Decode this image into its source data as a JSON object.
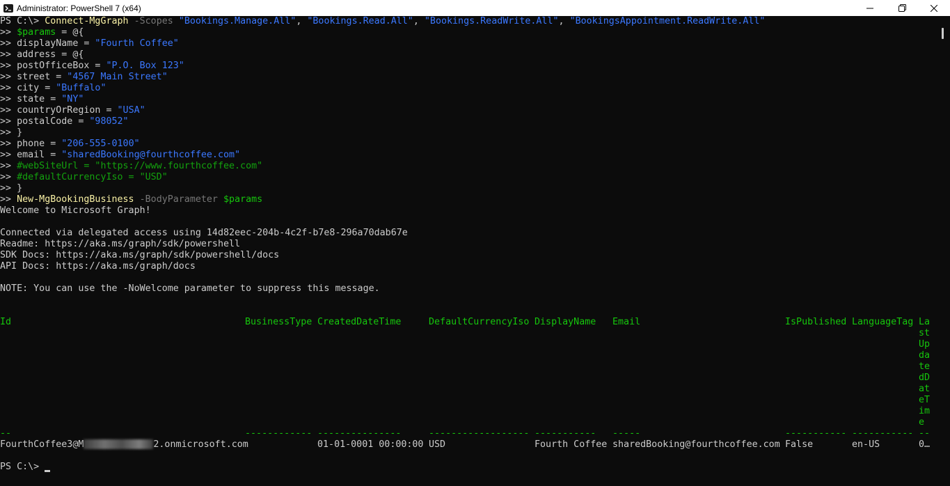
{
  "window": {
    "title": "Administrator: PowerShell 7 (x64)",
    "controls": [
      "minimize-icon",
      "restore-icon",
      "close-icon"
    ]
  },
  "colors": {
    "background": "#0c0c0c",
    "foreground": "#cccccc",
    "command": "#f9f1a5",
    "parameter": "#767676",
    "string": "#3b78ff",
    "variable": "#16c60c",
    "comment": "#13a10e",
    "table_header": "#16c60c"
  },
  "console": {
    "l1": {
      "prompt": "PS C:\\> ",
      "cmd": "Connect-MgGraph",
      "param": " -Scopes ",
      "s1": "\"Bookings.Manage.All\"",
      "sep1": ", ",
      "s2": "\"Bookings.Read.All\"",
      "sep2": ", ",
      "s3": "\"Bookings.ReadWrite.All\"",
      "sep3": ", ",
      "s4": "\"BookingsAppointment.ReadWrite.All\""
    },
    "l2": {
      "prompt": ">> ",
      "var": "$params",
      "rest": " = @{"
    },
    "l3": {
      "prompt": ">> ",
      "text": "displayName = ",
      "str": "\"Fourth Coffee\""
    },
    "l4": {
      "prompt": ">> ",
      "text": "address = @{"
    },
    "l5": {
      "prompt": ">> ",
      "text": "postOfficeBox = ",
      "str": "\"P.O. Box 123\""
    },
    "l6": {
      "prompt": ">> ",
      "text": "street = ",
      "str": "\"4567 Main Street\""
    },
    "l7": {
      "prompt": ">> ",
      "text": "city = ",
      "str": "\"Buffalo\""
    },
    "l8": {
      "prompt": ">> ",
      "text": "state = ",
      "str": "\"NY\""
    },
    "l9": {
      "prompt": ">> ",
      "text": "countryOrRegion = ",
      "str": "\"USA\""
    },
    "l10": {
      "prompt": ">> ",
      "text": "postalCode = ",
      "str": "\"98052\""
    },
    "l11": {
      "prompt": ">> ",
      "text": "}"
    },
    "l12": {
      "prompt": ">> ",
      "text": "phone = ",
      "str": "\"206-555-0100\""
    },
    "l13": {
      "prompt": ">> ",
      "text": "email = ",
      "str": "\"sharedBooking@fourthcoffee.com\""
    },
    "l14": {
      "prompt": ">> ",
      "comment": "#webSiteUrl = \"https://www.fourthcoffee.com\""
    },
    "l15": {
      "prompt": ">> ",
      "comment": "#defaultCurrencyIso = \"USD\""
    },
    "l16": {
      "prompt": ">> ",
      "text": "}"
    },
    "l17": {
      "prompt": ">> ",
      "cmd": "New-MgBookingBusiness",
      "param": " -BodyParameter ",
      "var": "$params"
    },
    "welcome": "Welcome to Microsoft Graph!",
    "connected": "Connected via delegated access using 14d82eec-204b-4c2f-b7e8-296a70dab67e",
    "readme": "Readme: https://aka.ms/graph/sdk/powershell",
    "sdk_docs": "SDK Docs: https://aka.ms/graph/sdk/powershell/docs",
    "api_docs": "API Docs: https://aka.ms/graph/docs",
    "note": "NOTE: You can use the -NoWelcome parameter to suppress this message.",
    "final_prompt": "PS C:\\> "
  },
  "table": {
    "headers": {
      "id": "Id",
      "business_type": "BusinessType",
      "created": "CreatedDateTime",
      "currency": "DefaultCurrencyIso",
      "display_name": "DisplayName",
      "email": "Email",
      "is_published": "IsPublished",
      "language_tag": "LanguageTag",
      "last_updated_chunks": [
        "La",
        "st",
        "Up",
        "da",
        "te",
        "dD",
        "at",
        "eT",
        "im",
        "e"
      ]
    },
    "separators": {
      "id": "--",
      "business_type": "------------",
      "created": "---------------",
      "currency": "------------------",
      "display_name": "-----------",
      "email": "-----",
      "is_published": "-----------",
      "language_tag": "-----------",
      "last_updated": "--"
    },
    "row": {
      "id_prefix": "FourthCoffee3@M",
      "id_suffix": "2.onmicrosoft.com",
      "created": "01-01-0001 00:00:00",
      "currency": "USD",
      "display_name": "Fourth Coffee",
      "email": "sharedBooking@fourthcoffee.com",
      "is_published": "False",
      "language_tag": "en-US",
      "last_updated": "0…"
    }
  }
}
